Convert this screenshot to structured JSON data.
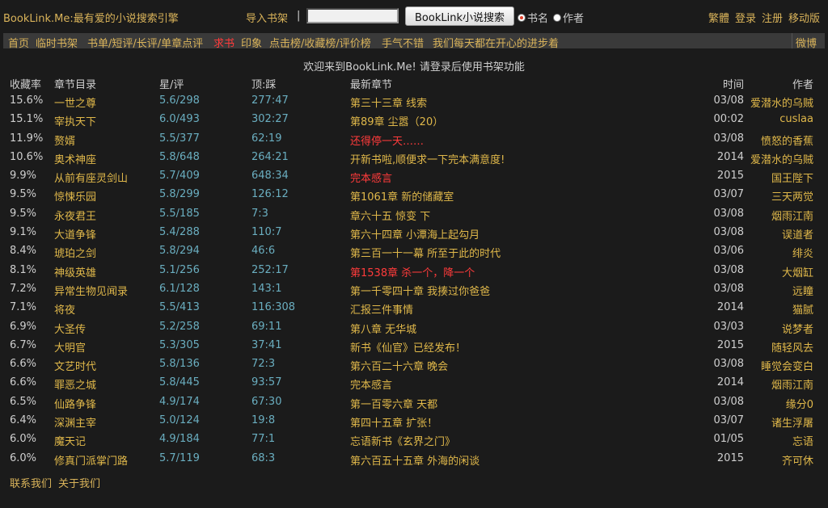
{
  "header": {
    "brand": "BookLink.Me:最有爱的小说搜索引擎",
    "import_label": "导入书架",
    "separator": "|",
    "search_value": "",
    "search_button": "BookLink小说搜索",
    "radio_title": "书名",
    "radio_author": "作者",
    "links": [
      "繁體",
      "登录",
      "注册",
      "移动版"
    ]
  },
  "nav": {
    "items": [
      "首页",
      "临时书架",
      "书单/短评/长评/单章点评",
      "求书",
      "印象",
      "点击榜/收藏榜/评价榜",
      "手气不错",
      "我们每天都在开心的进步着"
    ],
    "weibo": "微博"
  },
  "welcome": "欢迎来到BookLink.Me! 请登录后使用书架功能",
  "table": {
    "headers": [
      "收藏率",
      "章节目录",
      "星/评",
      "顶:踩",
      "最新章节",
      "时间",
      "作者"
    ],
    "rows": [
      {
        "rate": "15.6%",
        "name": "一世之尊",
        "star": "5.6/298",
        "vote": "277:47",
        "chapter": "第三十三章 线索",
        "time": "03/08",
        "author": "爱潜水的乌贼",
        "red": false
      },
      {
        "rate": "15.1%",
        "name": "宰执天下",
        "star": "6.0/493",
        "vote": "302:27",
        "chapter": "第89章 尘嚣（20）",
        "time": "00:02",
        "author": "cuslaa",
        "red": false
      },
      {
        "rate": "11.9%",
        "name": "赘婿",
        "star": "5.5/377",
        "vote": "62:19",
        "chapter": "还得停一天……",
        "time": "03/08",
        "author": "愤怒的香蕉",
        "red": true
      },
      {
        "rate": "10.6%",
        "name": "奥术神座",
        "star": "5.8/648",
        "vote": "264:21",
        "chapter": "开新书啦,顺便求一下完本满意度!",
        "time": "2014",
        "author": "爱潜水的乌贼",
        "red": false
      },
      {
        "rate": "9.9%",
        "name": "从前有座灵剑山",
        "star": "5.7/409",
        "vote": "648:34",
        "chapter": "完本感言",
        "time": "2015",
        "author": "国王陛下",
        "red": true
      },
      {
        "rate": "9.5%",
        "name": "惊悚乐园",
        "star": "5.8/299",
        "vote": "126:12",
        "chapter": "第1061章 新的储藏室",
        "time": "03/07",
        "author": "三天两觉",
        "red": false
      },
      {
        "rate": "9.5%",
        "name": "永夜君王",
        "star": "5.5/185",
        "vote": "7:3",
        "chapter": "章六十五 惊变 下",
        "time": "03/08",
        "author": "烟雨江南",
        "red": false
      },
      {
        "rate": "9.1%",
        "name": "大道争锋",
        "star": "5.4/288",
        "vote": "110:7",
        "chapter": "第六十四章 小潭海上起勾月",
        "time": "03/08",
        "author": "误道者",
        "red": false
      },
      {
        "rate": "8.4%",
        "name": "琥珀之剑",
        "star": "5.8/294",
        "vote": "46:6",
        "chapter": "第三百一十一幕 所至于此的时代",
        "time": "03/06",
        "author": "绯炎",
        "red": false
      },
      {
        "rate": "8.1%",
        "name": "神级英雄",
        "star": "5.1/256",
        "vote": "252:17",
        "chapter": "第1538章 杀一个，降一个",
        "time": "03/08",
        "author": "大烟缸",
        "red": true
      },
      {
        "rate": "7.2%",
        "name": "异常生物见闻录",
        "star": "6.1/128",
        "vote": "143:1",
        "chapter": "第一千零四十章 我揍过你爸爸",
        "time": "03/08",
        "author": "远瞳",
        "red": false
      },
      {
        "rate": "7.1%",
        "name": "将夜",
        "star": "5.5/413",
        "vote": "116:308",
        "chapter": "汇报三件事情",
        "time": "2014",
        "author": "猫腻",
        "red": false
      },
      {
        "rate": "6.9%",
        "name": "大圣传",
        "star": "5.2/258",
        "vote": "69:11",
        "chapter": "第八章 无华城",
        "time": "03/03",
        "author": "说梦者",
        "red": false
      },
      {
        "rate": "6.7%",
        "name": "大明官",
        "star": "5.3/305",
        "vote": "37:41",
        "chapter": "新书《仙官》已经发布！",
        "time": "2015",
        "author": "随轻风去",
        "red": false
      },
      {
        "rate": "6.6%",
        "name": "文艺时代",
        "star": "5.8/136",
        "vote": "72:3",
        "chapter": "第六百二十六章 晚会",
        "time": "03/08",
        "author": "睡觉会变白",
        "red": false
      },
      {
        "rate": "6.6%",
        "name": "罪恶之城",
        "star": "5.8/445",
        "vote": "93:57",
        "chapter": "完本感言",
        "time": "2014",
        "author": "烟雨江南",
        "red": false
      },
      {
        "rate": "6.5%",
        "name": "仙路争锋",
        "star": "4.9/174",
        "vote": "67:30",
        "chapter": "第一百零六章 天都",
        "time": "03/08",
        "author": "缘分0",
        "red": false
      },
      {
        "rate": "6.4%",
        "name": "深渊主宰",
        "star": "5.0/124",
        "vote": "19:8",
        "chapter": "第四十五章 扩张！",
        "time": "03/07",
        "author": "诸生浮屠",
        "red": false
      },
      {
        "rate": "6.0%",
        "name": "魔天记",
        "star": "4.9/184",
        "vote": "77:1",
        "chapter": "忘语新书《玄界之门》",
        "time": "01/05",
        "author": "忘语",
        "red": false
      },
      {
        "rate": "6.0%",
        "name": "修真门派掌门路",
        "star": "5.7/119",
        "vote": "68:3",
        "chapter": "第六百五十五章 外海的闲谈",
        "time": "2015",
        "author": "齐可休",
        "red": false
      }
    ]
  },
  "footer": [
    "联系我们",
    "关于我们"
  ],
  "colors": {
    "background": "#1b1b1b",
    "gold": "#e0b84a",
    "teal": "#6aaec0",
    "red": "#ff3b3b",
    "nav_bg": "#3a3a3a"
  }
}
